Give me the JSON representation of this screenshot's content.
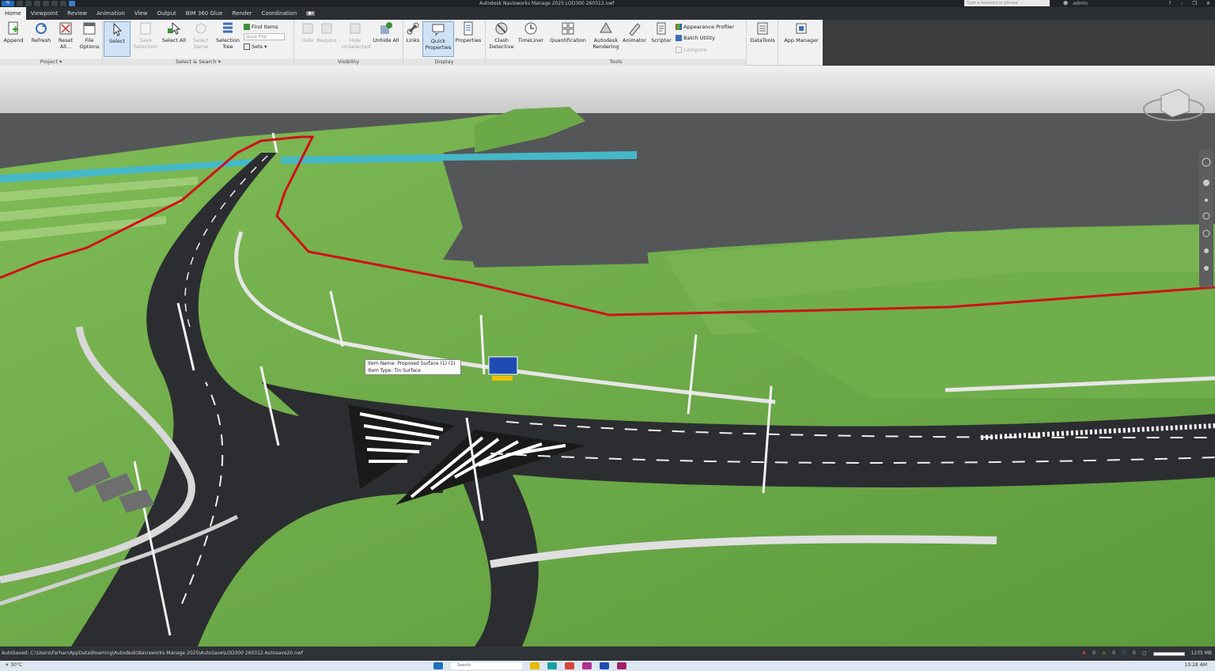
{
  "window": {
    "title": "Autodesk Navisworks Manage 2025    LOD300 260312.nwf",
    "search_placeholder": "Type a keyword or phrase",
    "user": "admin"
  },
  "menu": {
    "tabs": [
      "Home",
      "Viewpoint",
      "Review",
      "Animation",
      "View",
      "Output",
      "BIM 360 Glue",
      "Render",
      "Coordination"
    ],
    "active": "Home"
  },
  "ribbon": {
    "project": {
      "title": "Project",
      "append": "Append",
      "refresh": "Refresh",
      "reset_all": "Reset All...",
      "file_options": "File Options"
    },
    "select_search": {
      "title": "Select & Search",
      "select": "Select",
      "save_selection": "Save Selection",
      "select_all": "Select All",
      "select_same": "Select Same",
      "selection_tree": "Selection Tree",
      "find_items": "Find Items",
      "quick_find_placeholder": "Quick Find",
      "sets": "Sets"
    },
    "visibility": {
      "title": "Visibility",
      "hide": "Hide",
      "require": "Require",
      "hide_unselected": "Hide Unselected",
      "unhide_all": "Unhide All"
    },
    "display": {
      "title": "Display",
      "links": "Links",
      "quick_properties": "Quick Properties",
      "properties": "Properties"
    },
    "tools": {
      "title": "Tools",
      "clash_detective": "Clash Detective",
      "timeliner": "TimeLiner",
      "quantification": "Quantification",
      "autodesk_rendering": "Autodesk Rendering",
      "animator": "Animator",
      "scripter": "Scripter",
      "appearance_profiler": "Appearance Profiler",
      "batch_utility": "Batch Utility",
      "compare": "Compare"
    },
    "extra": {
      "datatools": "DataTools",
      "app_manager": "App Manager"
    }
  },
  "tooltip": {
    "line1": "Item Name: Proposed Surface (1) (1)",
    "line2": "Item Type: Tin Surface"
  },
  "status": {
    "autosave": "AutoSaved: C:\\Users\\Farhan\\AppData\\Roaming\\Autodesk\\Navisworks Manage 2025\\AutoSave\\LOD300 260312.Autosave20.nwf",
    "count1": "0",
    "count2": "0",
    "count3": "0",
    "memory": "1235 MB"
  },
  "taskbar": {
    "weather": "30°C",
    "search": "Search",
    "time": "10:28 AM"
  },
  "colors": {
    "ribbon_bg": "#f1f1f1",
    "titlebar": "#1f2327",
    "selected": "#cfe2f6",
    "grass": "#6ea84a",
    "road": "#2c2d30",
    "alignment": "#d0101a",
    "water": "#3fb8c4"
  }
}
